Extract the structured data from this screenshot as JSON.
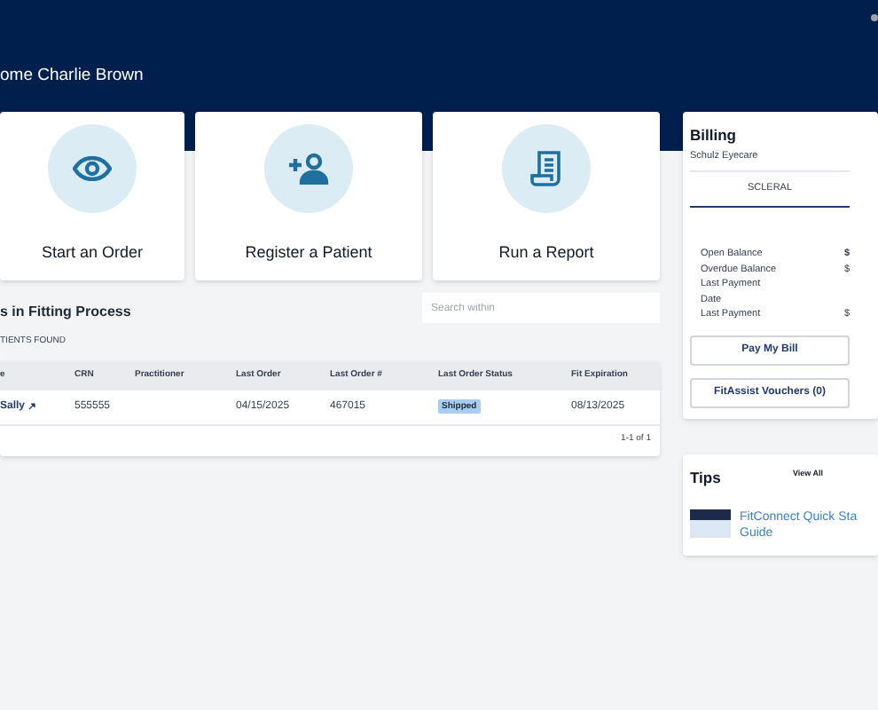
{
  "header": {
    "welcome": "ome Charlie Brown"
  },
  "actions": [
    {
      "label": "Start an Order",
      "kind": "eye"
    },
    {
      "label": "Register a Patient",
      "kind": "add-user"
    },
    {
      "label": "Run a Report",
      "kind": "report"
    }
  ],
  "fitting": {
    "title": "s in Fitting Process",
    "count": "TIENTS FOUND",
    "search": {
      "placeholder": "Search within"
    },
    "table": {
      "columns": [
        "e",
        "CRN",
        "Practitioner",
        "Last Order",
        "Last Order #",
        "Last Order Status",
        "Fit Expiration"
      ],
      "rows": [
        {
          "name": "Sally",
          "crn": "555555",
          "last_order": "04/15/2025",
          "order_no": "467015",
          "status": "Shipped",
          "fit_expiration": "08/13/2025"
        }
      ]
    },
    "pagination": "1-1 of 1"
  },
  "billing": {
    "title": "Billing",
    "subtitle": "Schulz Eyecare",
    "tabs": [
      {
        "label": "SCLERAL",
        "selected": true
      }
    ],
    "rows": [
      {
        "label": "Open Balance",
        "value": "$",
        "bold": true
      },
      {
        "label": "Overdue Balance",
        "value": "$",
        "bold": false
      },
      {
        "label": "Last Payment Date"
      },
      {
        "label": "Last Payment",
        "value": "$",
        "bold": false
      }
    ],
    "buttons": [
      "Pay My Bill",
      "FitAssist Vouchers (0)"
    ]
  },
  "tips": {
    "title": "Tips",
    "view_all": "View All",
    "items": [
      {
        "title": "FitConnect Quick Sta Guide"
      }
    ]
  }
}
